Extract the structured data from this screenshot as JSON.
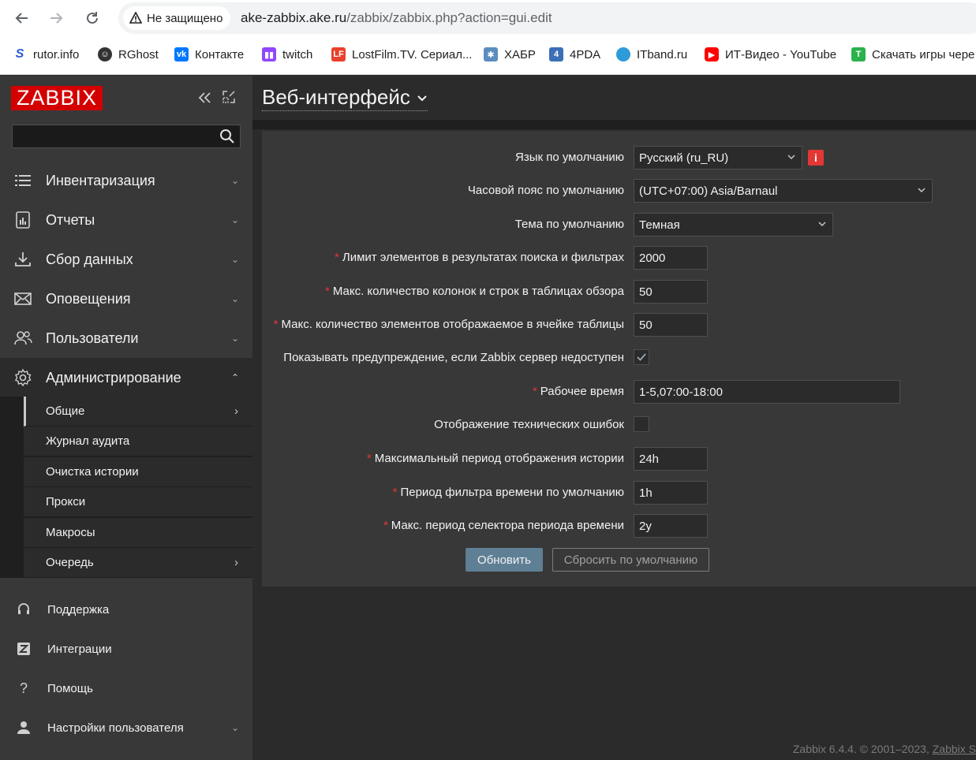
{
  "browser": {
    "security_label": "Не защищено",
    "url_host": "ake-zabbix.ake.ru",
    "url_path": "/zabbix/zabbix.php?action=gui.edit",
    "bookmarks": [
      {
        "label": "rutor.info",
        "icon": "rutor-icon",
        "color": "#2a5bd7"
      },
      {
        "label": "RGhost",
        "icon": "rghost-icon",
        "color": "#333333"
      },
      {
        "label": "Контакте",
        "icon": "vk-icon",
        "color": "#0077ff"
      },
      {
        "label": "twitch",
        "icon": "twitch-icon",
        "color": "#9146ff"
      },
      {
        "label": "LostFilm.TV. Сериал...",
        "icon": "lostfilm-icon",
        "color": "#e8412c"
      },
      {
        "label": "ХАБР",
        "icon": "habr-icon",
        "color": "#5b8dbf"
      },
      {
        "label": "4PDA",
        "icon": "4pda-icon",
        "color": "#3b6fb6"
      },
      {
        "label": "ITband.ru",
        "icon": "itband-icon",
        "color": "#2d9bd8"
      },
      {
        "label": "ИТ-Видео - YouTube",
        "icon": "youtube-icon",
        "color": "#ff0000"
      },
      {
        "label": "Скачать игры чере",
        "icon": "torrent-icon",
        "color": "#2bb24c"
      }
    ]
  },
  "sidebar": {
    "logo": "ZABBIX",
    "menu": [
      {
        "label": "Инвентаризация",
        "icon": "list-icon",
        "expanded": false
      },
      {
        "label": "Отчеты",
        "icon": "report-icon",
        "expanded": false
      },
      {
        "label": "Сбор данных",
        "icon": "download-icon",
        "expanded": false
      },
      {
        "label": "Оповещения",
        "icon": "envelope-icon",
        "expanded": false
      },
      {
        "label": "Пользователи",
        "icon": "users-icon",
        "expanded": false
      },
      {
        "label": "Администрирование",
        "icon": "gear-icon",
        "expanded": true
      }
    ],
    "submenu": [
      {
        "label": "Общие",
        "has_children": true,
        "selected": true
      },
      {
        "label": "Журнал аудита",
        "has_children": false
      },
      {
        "label": "Очистка истории",
        "has_children": false
      },
      {
        "label": "Прокси",
        "has_children": false
      },
      {
        "label": "Макросы",
        "has_children": false
      },
      {
        "label": "Очередь",
        "has_children": true
      }
    ],
    "bottom": [
      {
        "label": "Поддержка",
        "icon": "headset-icon"
      },
      {
        "label": "Интеграции",
        "icon": "zabbix-z-icon"
      },
      {
        "label": "Помощь",
        "icon": "question-icon"
      },
      {
        "label": "Настройки пользователя",
        "icon": "user-icon"
      }
    ]
  },
  "main": {
    "title": "Веб-интерфейс",
    "form": {
      "language_label": "Язык по умолчанию",
      "language_value": "Русский (ru_RU)",
      "timezone_label": "Часовой пояс по умолчанию",
      "timezone_value": "(UTC+07:00) Asia/Barnaul",
      "theme_label": "Тема по умолчанию",
      "theme_value": "Темная",
      "search_limit_label": "Лимит элементов в результатах поиска и фильтрах",
      "search_limit_value": "2000",
      "max_overview_label": "Макс. количество колонок и строк в таблицах обзора",
      "max_overview_value": "50",
      "max_in_table_label": "Макс. количество элементов отображаемое в ячейке таблицы",
      "max_in_table_value": "50",
      "server_check_label": "Показывать предупреждение, если Zabbix сервер недоступен",
      "server_check_checked": true,
      "work_period_label": "Рабочее время",
      "work_period_value": "1-5,07:00-18:00",
      "tech_errors_label": "Отображение технических ошибок",
      "tech_errors_checked": false,
      "history_period_label": "Максимальный период отображения истории",
      "history_period_value": "24h",
      "filter_period_label": "Период фильтра времени по умолчанию",
      "filter_period_value": "1h",
      "max_period_label": "Макс. период селектора периода времени",
      "max_period_value": "2y",
      "update_button": "Обновить",
      "reset_button": "Сбросить по умолчанию",
      "required_mark": "*",
      "info_mark": "i"
    },
    "footer_text": "Zabbix 6.4.4. © 2001–2023,",
    "footer_link": "Zabbix S"
  }
}
